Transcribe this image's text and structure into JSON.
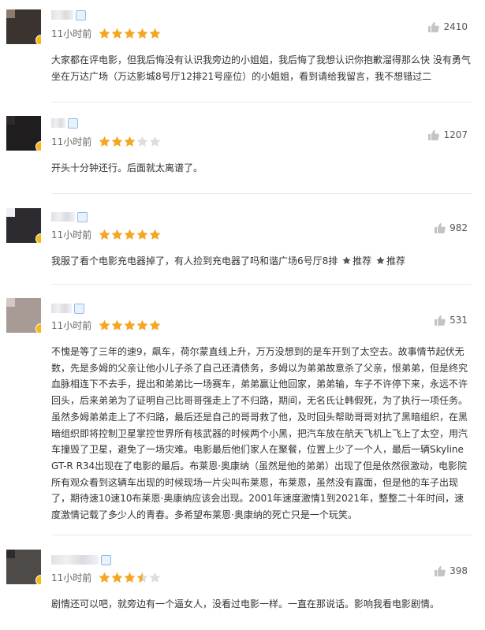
{
  "reviews": [
    {
      "time": "11小时前",
      "rating": 5,
      "likes": "2410",
      "text": "大家都在评电影，但我后悔没有认识我旁边的小姐姐，我后悔了我想认识你抱歉溜得那么快 没有勇气 坐在万达广场（万达影城8号厅12排21号座位）的小姐姐，看到请给我留言，我不想错过二"
    },
    {
      "time": "11小时前",
      "rating": 3,
      "likes": "1207",
      "text": "开头十分钟还行。后面就太离谱了。"
    },
    {
      "time": "11小时前",
      "rating": 5,
      "likes": "982",
      "text_parts": [
        "我服了看个电影充电器掉了，有人捡到充电器了吗和谐广场6号厅8排",
        "推荐",
        "推荐"
      ]
    },
    {
      "time": "11小时前",
      "rating": 5,
      "likes": "531",
      "text": "不愧是等了三年的速9，飙车，荷尔蒙直线上升，万万没想到的是车开到了太空去。故事情节起伏无数，先是多姆的父亲让他小儿子杀了自己还清债务，多姆以为弟弟故意杀了父亲，恨弟弟，但是终究血脉相连下不去手，提出和弟弟比一场赛车，弟弟赢让他回家，弟弟输，车子不许停下来，永远不许回头，后来弟弟为了证明自己比哥哥强走上了不归路，期间，无名氏让韩假死，为了执行一项任务。虽然多姆弟弟走上了不归路，最后还是自己的哥哥救了他，及时回头帮助哥哥对抗了黑暗组织，在黑暗组织即将控制卫星掌控世界所有核武器的时候两个小黑，把汽车放在航天飞机上飞上了太空，用汽车撞毁了卫星，避免了一场灾难。电影最后他们家人在聚餐，位置上少了一个人，最后一辆Skyline GT-R R34出现在了电影的最后。布莱恩·奥康纳（虽然是他的弟弟）出现了但是依然很激动，电影院所有观众看到这辆车出现的时候现场一片尖叫布莱恩，布莱恩，虽然没有露面，但是他的车子出现了，期待速10速10布莱恩·奥康纳应该会出现。2001年速度激情1到2021年，整整二十年时间，速度激情记载了多少人的青春。多希望布莱恩·奥康纳的死亡只是一个玩笑。"
    },
    {
      "time": "11小时前",
      "rating": 3.5,
      "likes": "398",
      "text": "剧情还可以吧，就旁边有一个逼女人，没看过电影一样。一直在那说话。影响我看电影剧情。"
    }
  ],
  "colors": {
    "star_on": "#f5a623",
    "star_off": "#dddddd",
    "thumb": "#c4c4c4"
  },
  "icons": {
    "like": "thumbs-up-icon",
    "rating": "star-icon",
    "vip": "vip-badge-icon"
  }
}
